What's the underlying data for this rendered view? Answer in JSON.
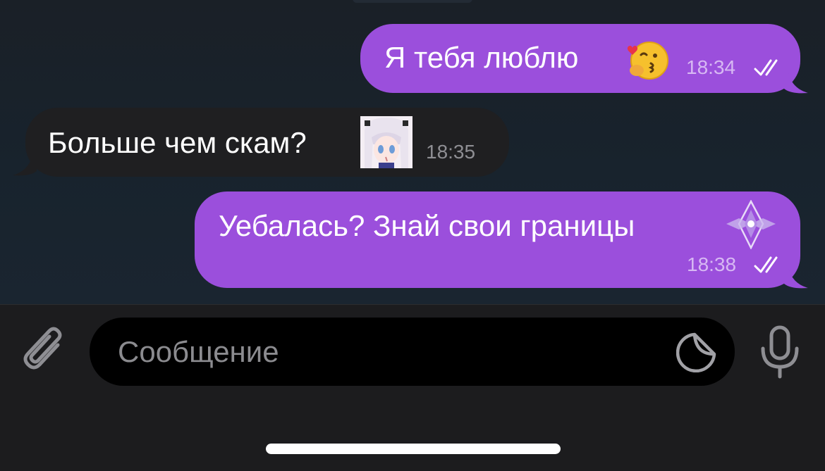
{
  "messages": [
    {
      "direction": "outgoing",
      "text": "Я тебя люблю",
      "emoji": "kissing-face-emoji",
      "time": "18:34",
      "status": "read"
    },
    {
      "direction": "incoming",
      "text": "Больше чем скам?",
      "emoji": "anime-girl-custom-emoji",
      "time": "18:35"
    },
    {
      "direction": "outgoing",
      "text": "Уебалась? Знай свои границы",
      "emoji": "crystal-custom-emoji",
      "time": "18:38",
      "status": "read"
    }
  ],
  "composer": {
    "placeholder": "Сообщение",
    "icons": [
      "paperclip-icon",
      "sticker-icon",
      "microphone-icon"
    ]
  },
  "colors": {
    "outgoing_bubble": "#9b4fdc",
    "incoming_bubble": "#1f1f21",
    "background": "#1a2530",
    "input_bar": "#1c1c1e"
  }
}
